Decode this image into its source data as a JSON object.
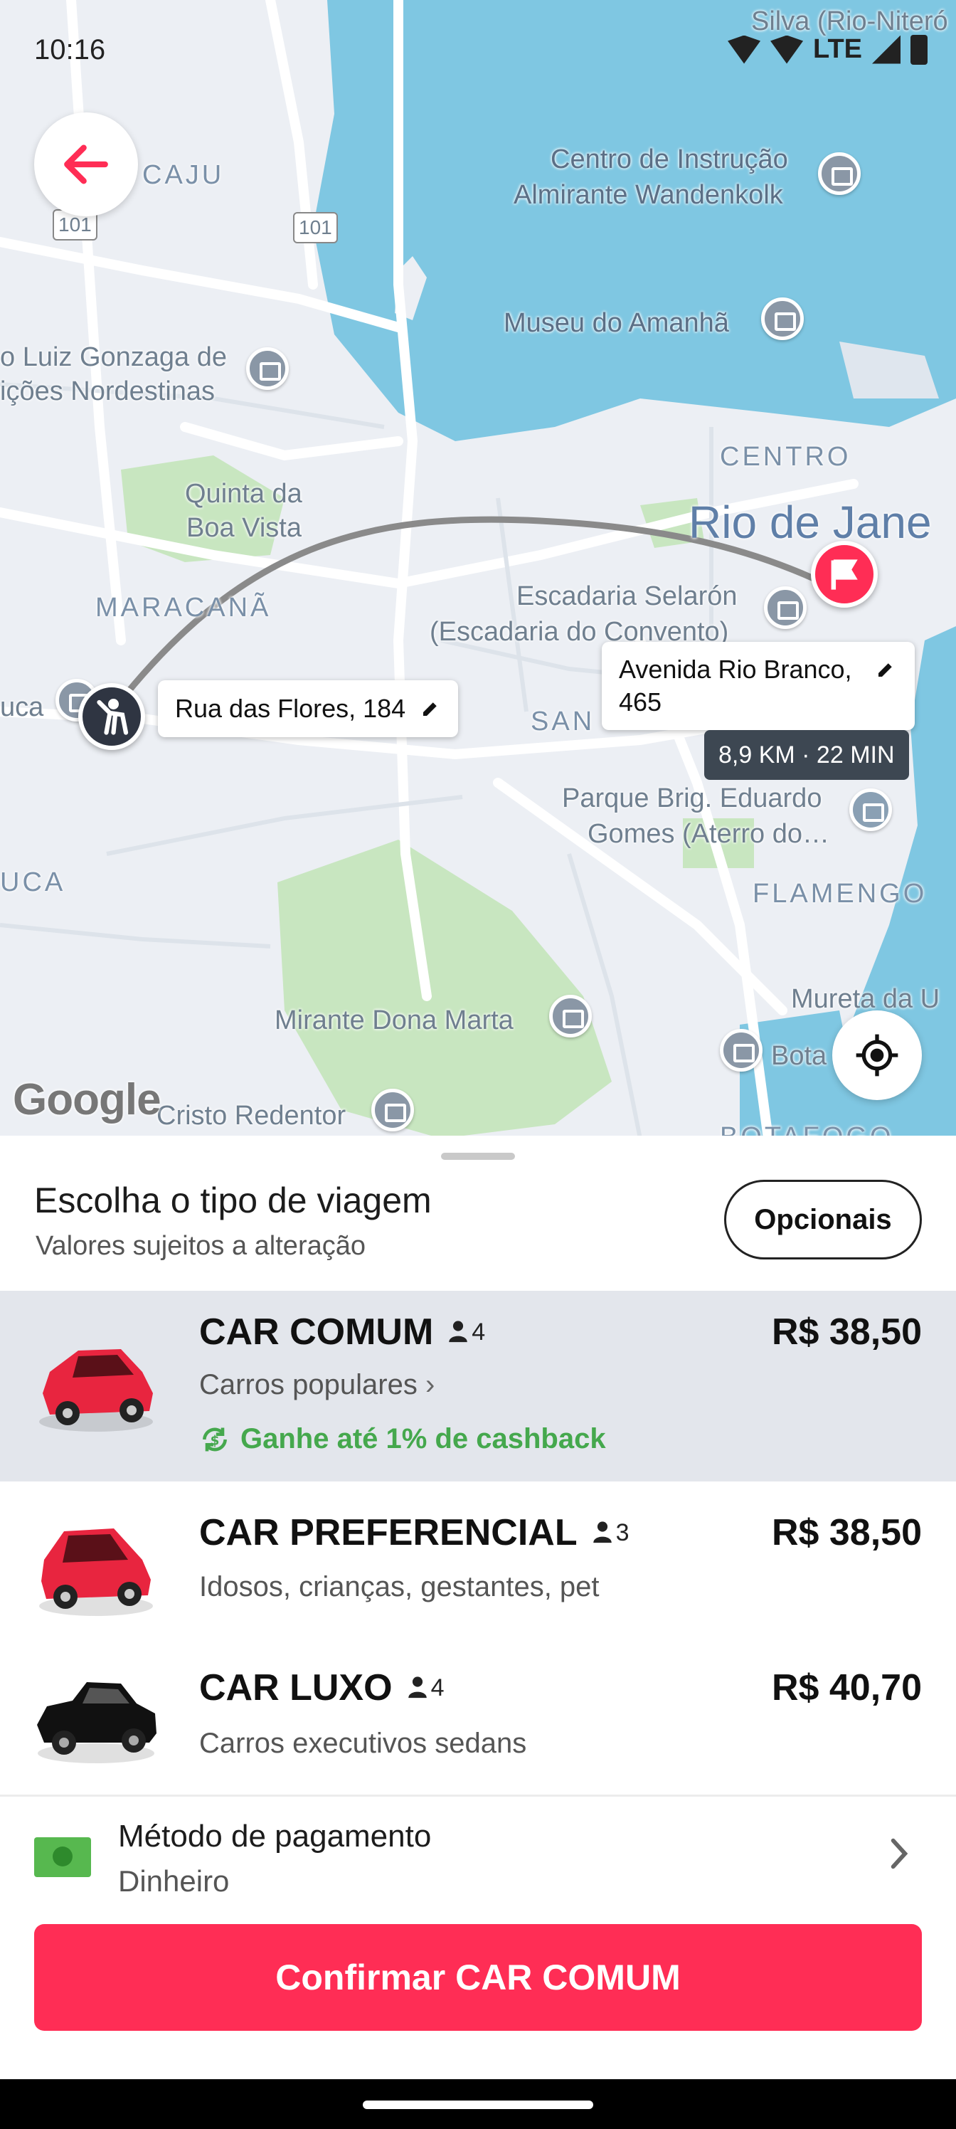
{
  "status_bar": {
    "time": "10:16",
    "network": "LTE"
  },
  "map": {
    "labels": {
      "silva": "Silva (Rio-Niteró",
      "caju": "CAJU",
      "centro_instrucao_1": "Centro de Instrução",
      "centro_instrucao_2": "Almirante Wandenkolk",
      "museu": "Museu do Amanhã",
      "luiz_gonzaga_1": "o Luiz Gonzaga de",
      "luiz_gonzaga_2": "ições Nordestinas",
      "centro": "CENTRO",
      "quinta_1": "Quinta da",
      "quinta_2": "Boa Vista",
      "rio": "Rio de Jane",
      "maracana": "MARACANÃ",
      "escadaria_1": "Escadaria Selarón",
      "escadaria_2": "(Escadaria do Convento)",
      "uca": "uca",
      "san": "SAN",
      "parque_1": "Parque Brig. Eduardo",
      "parque_2": "Gomes (Aterro do…",
      "flamengo": "FLAMENGO",
      "uca2": "UCA",
      "mureta": "Mureta da U",
      "mirante": "Mirante Dona Marta",
      "bota": "Bota",
      "cristo": "Cristo Redentor",
      "botafogo": "BOTAFOGO",
      "road_101_a": "101",
      "road_101_b": "101"
    },
    "origin_address": "Rua das Flores, 184",
    "destination_address": "Avenida Rio Branco, 465",
    "route_info": "8,9 KM · 22 MIN",
    "google_logo": "Google"
  },
  "sheet": {
    "title": "Escolha o tipo de viagem",
    "subtitle": "Valores sujeitos a alteração",
    "options_button": "Opcionais",
    "rides": [
      {
        "name": "CAR COMUM",
        "seats": "4",
        "description": "Carros populares",
        "price": "R$ 38,50",
        "cashback": "Ganhe até 1% de cashback",
        "car_color": "#e8253f"
      },
      {
        "name": "CAR PREFERENCIAL",
        "seats": "3",
        "description": "Idosos, crianças, gestantes, pet",
        "price": "R$ 38,50",
        "car_color": "#e8253f"
      },
      {
        "name": "CAR LUXO",
        "seats": "4",
        "description": "Carros executivos sedans",
        "price": "R$ 40,70",
        "car_color": "#111111"
      }
    ],
    "payment": {
      "title": "Método de pagamento",
      "value": "Dinheiro"
    },
    "confirm_button": "Confirmar CAR COMUM"
  },
  "colors": {
    "accent": "#ff2d55",
    "water": "#7fc7e2",
    "park": "#c8e6c0",
    "cashback": "#45a84d",
    "selected_row": "#e3e6ec"
  }
}
